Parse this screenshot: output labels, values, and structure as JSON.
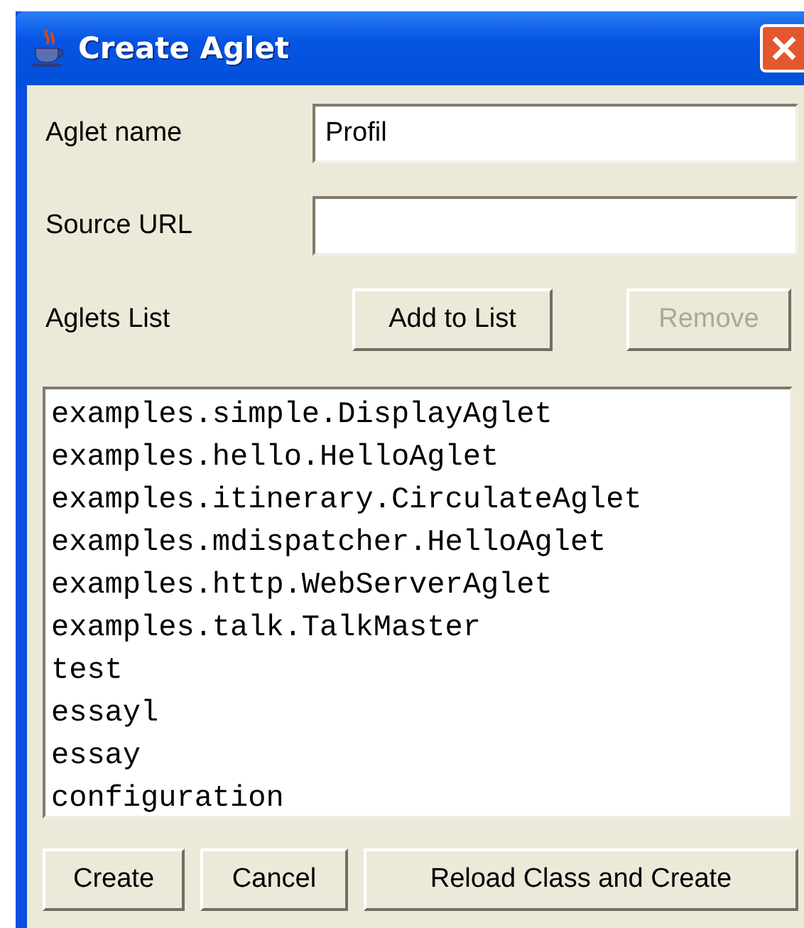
{
  "window": {
    "title": "Create Aglet"
  },
  "fields": [
    {
      "label": "Aglet name",
      "value": "Profil"
    },
    {
      "label": "Source URL"
    }
  ],
  "list_label": "Aglets List",
  "list_buttons": [
    {
      "label": "Add to List",
      "disabled": false
    },
    {
      "label": "Remove",
      "disabled": true
    }
  ],
  "aglets": [
    "examples.simple.DisplayAglet",
    "examples.hello.HelloAglet",
    "examples.itinerary.CirculateAglet",
    "examples.mdispatcher.HelloAglet",
    "examples.http.WebServerAglet",
    "examples.talk.TalkMaster",
    "test",
    "essayl",
    "essay",
    "configuration"
  ],
  "buttons": [
    {
      "label": "Create",
      "disabled": false
    },
    {
      "label": "Cancel",
      "disabled": false
    },
    {
      "label": "Reload Class and Create",
      "disabled": false
    }
  ]
}
